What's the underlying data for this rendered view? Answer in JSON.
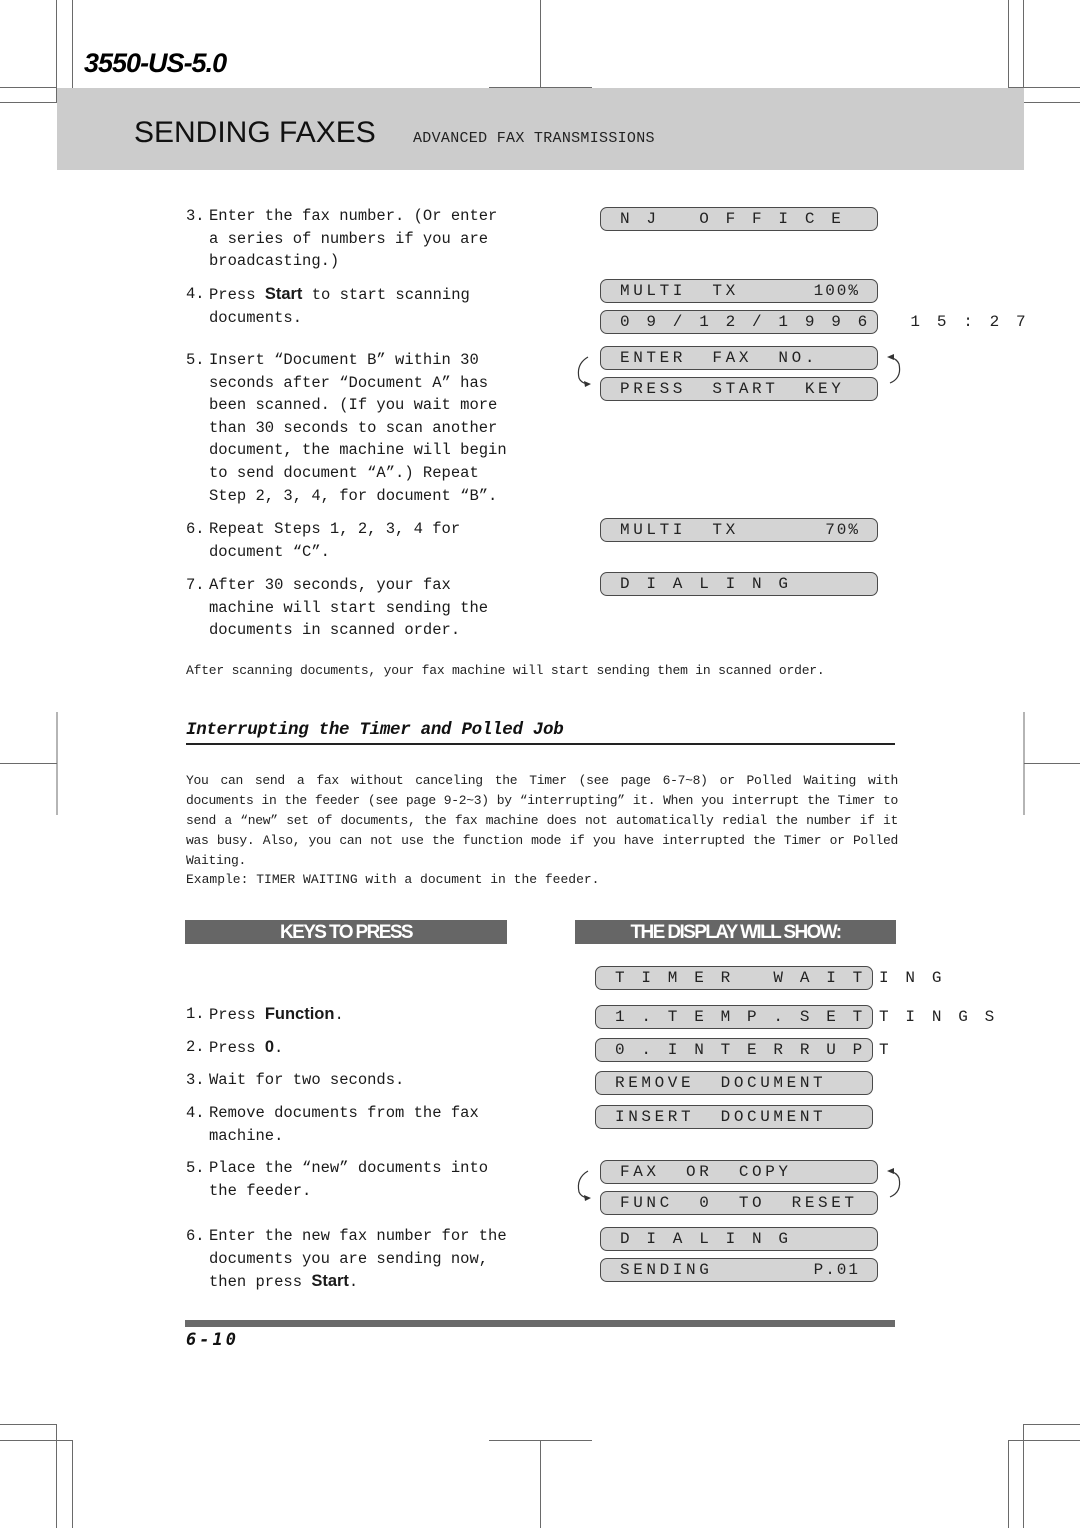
{
  "header": {
    "model_code": "3550-US-5.0",
    "section_title": "SENDING FAXES",
    "section_subtitle": "ADVANCED FAX TRANSMISSIONS"
  },
  "multi_tx_steps": [
    {
      "num": "3.",
      "text": "Enter the fax number. (Or enter a series of numbers if you are broadcasting.)"
    },
    {
      "num": "4.",
      "pre": "Press ",
      "key": "Start",
      "post": " to start scanning documents."
    },
    {
      "num": "5.",
      "text": "Insert “Document B” within 30 seconds after “Document A” has been scanned. (If you wait more than 30 seconds to scan another document, the machine will begin to send document “A”.) Repeat Step 2, 3, 4, for document “B”."
    },
    {
      "num": "6.",
      "text": "Repeat Steps 1, 2, 3, 4 for document “C”."
    },
    {
      "num": "7.",
      "text": "After 30 seconds, your fax machine will start sending the documents in scanned order."
    }
  ],
  "multi_tx_displays": [
    {
      "left": "N J   O F F I C E",
      "right": ""
    },
    {
      "left": "MULTI  TX",
      "right": "100%"
    },
    {
      "left": "0 9 / 1 2 / 1 9 9 6   1 5 : 2 7",
      "right": ""
    },
    {
      "left": "ENTER  FAX  NO.",
      "right": ""
    },
    {
      "left": "PRESS  START  KEY",
      "right": ""
    },
    {
      "left": "MULTI  TX",
      "right": "70%"
    },
    {
      "left": "D I A L I N G",
      "right": ""
    }
  ],
  "note": "After scanning documents, your fax machine will start sending them in scanned order.",
  "interrupt_section": {
    "heading": "Interrupting the Timer and Polled Job",
    "paragraph": "You can send a fax without canceling the Timer (see page 6-7~8) or Polled Waiting with documents in the feeder (see page 9-2~3) by “interrupting” it. When you interrupt the Timer to send a “new” set of documents, the fax machine does not automatically redial the number if it was busy. Also, you can not use the function mode if you have interrupted the Timer or Polled Waiting.",
    "example": "Example: TIMER WAITING with a document in the feeder.",
    "keys_header": "KEYS TO PRESS",
    "display_header": "THE DISPLAY WILL SHOW:",
    "steps": [
      {
        "num": "1.",
        "pre": "Press ",
        "key": "Function",
        "post": "."
      },
      {
        "num": "2.",
        "pre": "Press ",
        "key": "0",
        "post": "."
      },
      {
        "num": "3.",
        "text": "Wait for two seconds."
      },
      {
        "num": "4.",
        "text": "Remove documents from the fax machine."
      },
      {
        "num": "5.",
        "text": "Place the “new” documents into the feeder."
      },
      {
        "num": "6.",
        "pre": "Enter the new fax number for the documents you are sending now, then press ",
        "key": "Start",
        "post": "."
      }
    ],
    "displays": [
      {
        "left": "T I M E R   W A I T I N G",
        "right": ""
      },
      {
        "left": "1 . T E M P . S E T T I N G S",
        "right": ""
      },
      {
        "left": "0 . I N T E R R U P T",
        "right": ""
      },
      {
        "left": "REMOVE  DOCUMENT",
        "right": ""
      },
      {
        "left": "INSERT  DOCUMENT",
        "right": ""
      },
      {
        "left": "FAX  OR  COPY",
        "right": ""
      },
      {
        "left": "FUNC  0  TO  RESET",
        "right": ""
      },
      {
        "left": "D I A L I N G",
        "right": ""
      },
      {
        "left": "SENDING",
        "right": "P.01"
      }
    ]
  },
  "footer": {
    "page_number": "6-10"
  }
}
